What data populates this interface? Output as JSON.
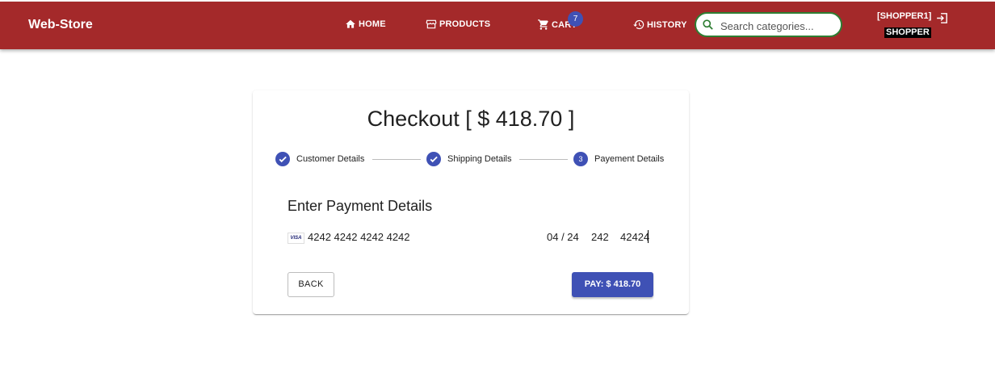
{
  "header": {
    "brand": "Web-Store",
    "nav": {
      "home": "HOME",
      "products": "PRODUCTS",
      "cart": "CART",
      "history": "HISTORY"
    },
    "cart_badge": "7",
    "search_placeholder": "Search categories...",
    "user_name": "[SHOPPER1]",
    "user_role": "SHOPPER"
  },
  "checkout": {
    "title": "Checkout [ $ 418.70 ]",
    "steps": [
      {
        "label": "Customer Details",
        "state": "completed"
      },
      {
        "label": "Shipping Details",
        "state": "completed"
      },
      {
        "label": "Payement Details",
        "state": "active",
        "number": "3"
      }
    ],
    "section_title": "Enter Payment Details",
    "card_brand": "VISA",
    "card_number": "4242 4242 4242 4242",
    "expiry": "04 / 24",
    "cvc": "242",
    "zip": "42424",
    "back_label": "BACK",
    "pay_label": "PAY: $ 418.70"
  },
  "colors": {
    "appbar": "#a4292a",
    "primary": "#3f51b5",
    "search_border": "#2e7d32"
  }
}
